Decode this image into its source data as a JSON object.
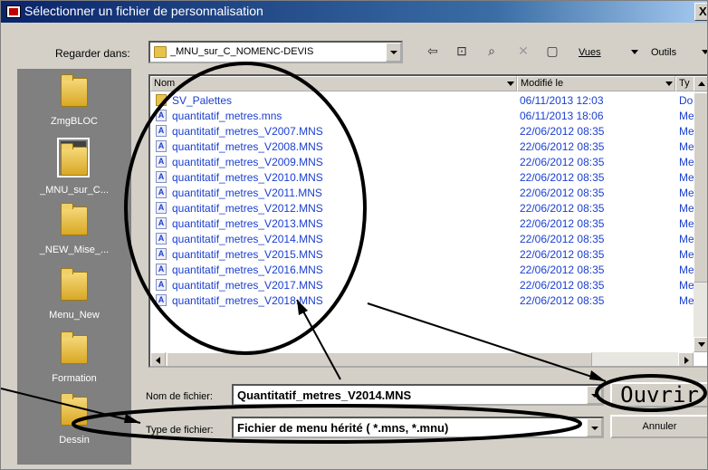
{
  "window": {
    "title": "Sélectionner un fichier de personnalisation",
    "close_glyph": "X"
  },
  "toolbar": {
    "look_in_label": "Regarder dans:",
    "look_in_value": "_MNU_sur_C_NOMENC-DEVIS",
    "views_label": "Vues",
    "tools_label": "Outils",
    "icons": [
      "back-icon",
      "up-folder-icon",
      "search-web-icon",
      "delete-icon",
      "new-folder-icon"
    ]
  },
  "places": [
    {
      "label": "ZmgBLOC",
      "selected": false
    },
    {
      "label": "_MNU_sur_C...",
      "selected": true
    },
    {
      "label": "_NEW_Mise_...",
      "selected": false
    },
    {
      "label": "Menu_New",
      "selected": false
    },
    {
      "label": "Formation",
      "selected": false
    },
    {
      "label": "Dessin",
      "selected": false
    }
  ],
  "columns": {
    "name": "Nom",
    "modified": "Modifié le",
    "type": "Ty"
  },
  "files": [
    {
      "name": "SV_Palettes",
      "modified": "06/11/2013 12:03",
      "type": "Do",
      "kind": "folder"
    },
    {
      "name": "quantitatif_metres.mns",
      "modified": "06/11/2013 18:06",
      "type": "Me",
      "kind": "file"
    },
    {
      "name": "quantitatif_metres_V2007.MNS",
      "modified": "22/06/2012 08:35",
      "type": "Me",
      "kind": "file"
    },
    {
      "name": "quantitatif_metres_V2008.MNS",
      "modified": "22/06/2012 08:35",
      "type": "Me",
      "kind": "file"
    },
    {
      "name": "quantitatif_metres_V2009.MNS",
      "modified": "22/06/2012 08:35",
      "type": "Me",
      "kind": "file"
    },
    {
      "name": "quantitatif_metres_V2010.MNS",
      "modified": "22/06/2012 08:35",
      "type": "Me",
      "kind": "file"
    },
    {
      "name": "quantitatif_metres_V2011.MNS",
      "modified": "22/06/2012 08:35",
      "type": "Me",
      "kind": "file"
    },
    {
      "name": "quantitatif_metres_V2012.MNS",
      "modified": "22/06/2012 08:35",
      "type": "Me",
      "kind": "file"
    },
    {
      "name": "quantitatif_metres_V2013.MNS",
      "modified": "22/06/2012 08:35",
      "type": "Me",
      "kind": "file"
    },
    {
      "name": "quantitatif_metres_V2014.MNS",
      "modified": "22/06/2012 08:35",
      "type": "Me",
      "kind": "file"
    },
    {
      "name": "quantitatif_metres_V2015.MNS",
      "modified": "22/06/2012 08:35",
      "type": "Me",
      "kind": "file"
    },
    {
      "name": "quantitatif_metres_V2016.MNS",
      "modified": "22/06/2012 08:35",
      "type": "Me",
      "kind": "file"
    },
    {
      "name": "quantitatif_metres_V2017.MNS",
      "modified": "22/06/2012 08:35",
      "type": "Me",
      "kind": "file"
    },
    {
      "name": "quantitatif_metres_V2018.MNS",
      "modified": "22/06/2012 08:35",
      "type": "Me",
      "kind": "file"
    }
  ],
  "bottom": {
    "filename_label": "Nom de fichier:",
    "filename_value": "Quantitatif_metres_V2014.MNS",
    "filetype_label": "Type de fichier:",
    "filetype_value": "Fichier de menu hérité ( *.mns, *.mnu)",
    "open_label": "Ouvrir",
    "cancel_label": "Annuler"
  },
  "colors": {
    "title_bar": "#0a246a",
    "file_text": "#1a3fd0",
    "places_bg": "#808080",
    "dialog_bg": "#d4d0c8"
  }
}
